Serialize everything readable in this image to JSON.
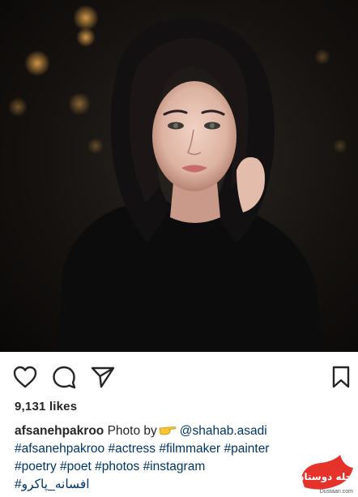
{
  "post": {
    "image_alt": "",
    "likes_text": "9,131 likes",
    "username": "afsanehpakroo",
    "caption_text": "Photo by",
    "mention": "@shahab.asadi",
    "hashtags_line1": "#afsanehpakroo #actress #filmmaker #painter",
    "hashtags_line2": "#poetry #poet #photos #instagram",
    "hashtags_line3": "#افسانه_پاکرو"
  },
  "actions": {
    "like_icon": "heart-outline-icon",
    "comment_icon": "comment-bubble-icon",
    "share_icon": "paper-plane-icon",
    "save_icon": "bookmark-icon"
  },
  "watermark": {
    "site": "Dustaan.com",
    "logo_text": "مجله دوستان"
  },
  "colors": {
    "text": "#262626",
    "link": "#003569",
    "watermark_red": "#e5322b"
  }
}
